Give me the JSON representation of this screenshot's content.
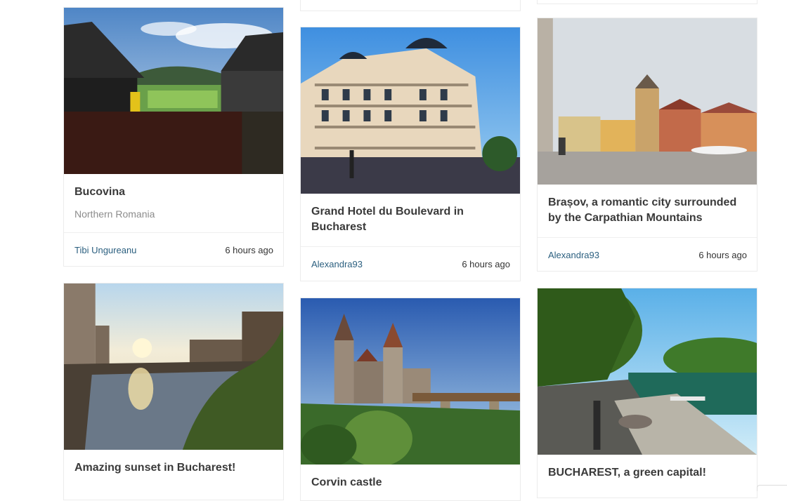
{
  "cards": [
    {
      "title": "Bucovina",
      "subtitle": "Northern Romania",
      "author": "Tibi Ungureanu",
      "time": "6 hours ago"
    },
    {
      "title": "Grand Hotel du Boulevard in Bucharest",
      "author": "Alexandra93",
      "time": "6 hours ago"
    },
    {
      "title": "Brașov, a romantic city surrounded by the Carpathian Mountains",
      "author": "Alexandra93",
      "time": "6 hours ago"
    },
    {
      "title": "Amazing sunset in Bucharest!"
    },
    {
      "title": "Corvin castle"
    },
    {
      "title": "BUCHAREST, a green capital!"
    }
  ]
}
